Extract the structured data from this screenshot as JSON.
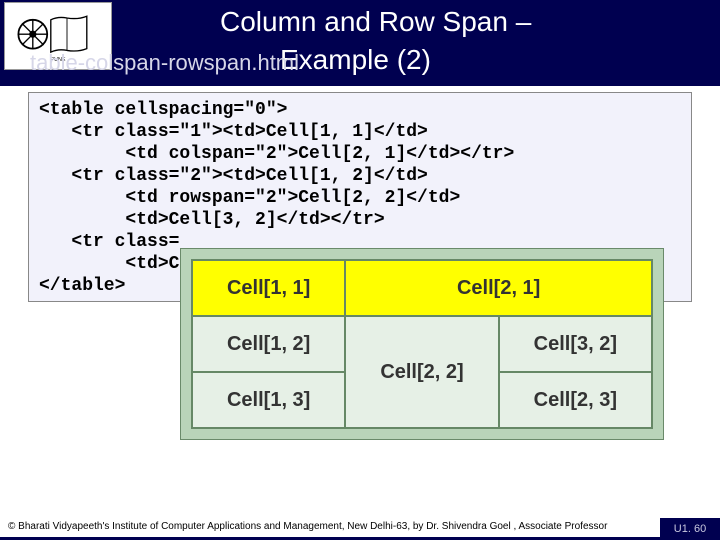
{
  "header": {
    "title_line1": "Column and Row Span –",
    "title_line2": "Example (2)",
    "filename": "table-colspan-rowspan.html"
  },
  "code": {
    "l1": "<table cellspacing=\"0\">",
    "l2": "   <tr class=\"1\"><td>Cell[1, 1]</td>",
    "l3": "        <td colspan=\"2\">Cell[2, 1]</td></tr>",
    "l4": "   <tr class=\"2\"><td>Cell[1, 2]</td>",
    "l5": "        <td rowspan=\"2\">Cell[2, 2]</td>",
    "l6": "        <td>Cell[3, 2]</td></tr>",
    "l7": "   <tr class=",
    "l8": "        <td>C",
    "l9": "</table>"
  },
  "demo": {
    "c11": "Cell[1, 1]",
    "c21": "Cell[2, 1]",
    "c12": "Cell[1, 2]",
    "c22": "Cell[2, 2]",
    "c32": "Cell[3, 2]",
    "c13": "Cell[1, 3]",
    "c23": "Cell[2, 3]"
  },
  "footer": {
    "copyright": "© Bharati Vidyapeeth's Institute of Computer Applications and Management, New Delhi-63, by Dr. Shivendra Goel , Associate Professor",
    "slide": "U1. 60"
  }
}
